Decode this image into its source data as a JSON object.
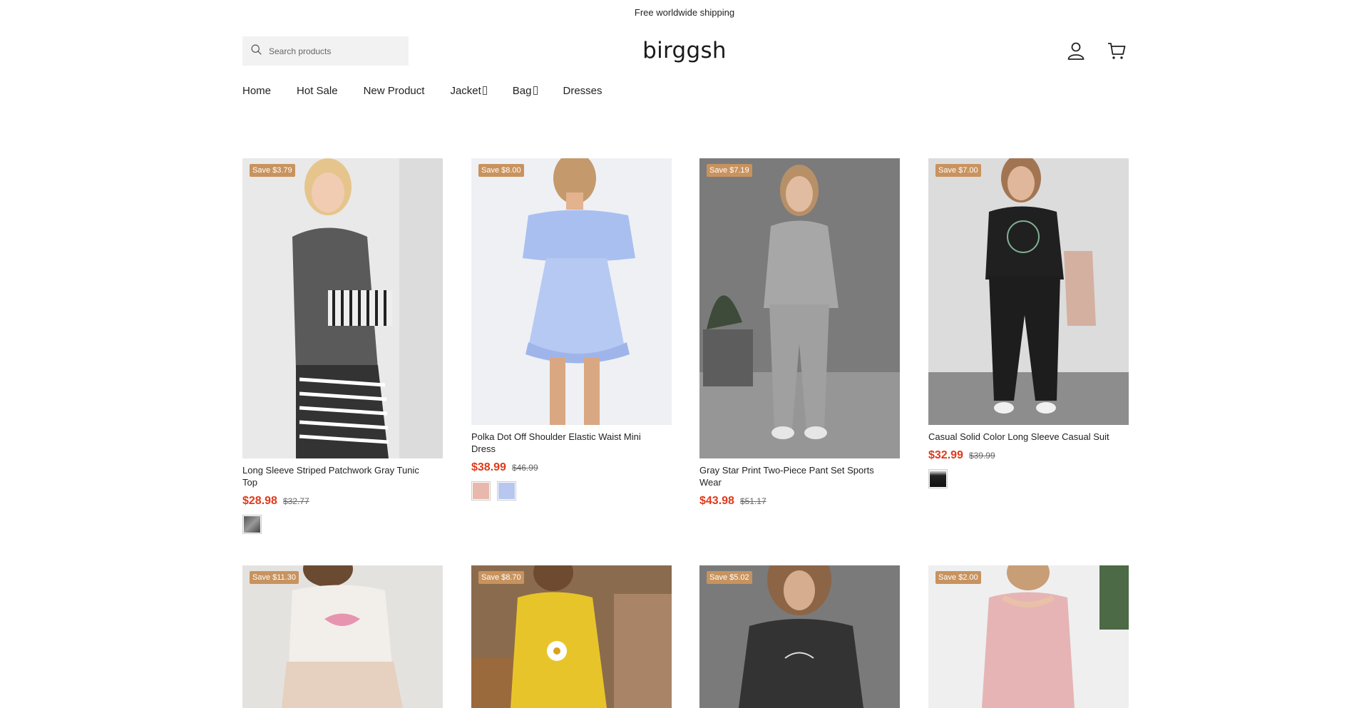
{
  "announcement": "Free worldwide shipping",
  "header": {
    "logo": "birggsh",
    "search_placeholder": "Search products"
  },
  "nav": [
    {
      "label": "Home"
    },
    {
      "label": "Hot Sale"
    },
    {
      "label": "New Product"
    },
    {
      "label": "Jacket"
    },
    {
      "label": "Bag"
    },
    {
      "label": "Dresses"
    }
  ],
  "products": [
    {
      "badge": "Save $3.79",
      "title": "Long Sleeve Striped Patchwork Gray Tunic Top",
      "price": "$28.98",
      "compare": "$32.77"
    },
    {
      "badge": "Save $8.00",
      "title": "Polka Dot Off Shoulder Elastic Waist Mini Dress",
      "price": "$38.99",
      "compare": "$46.99"
    },
    {
      "badge": "Save $7.19",
      "title": "Gray Star Print Two-Piece Pant Set Sports Wear",
      "price": "$43.98",
      "compare": "$51.17"
    },
    {
      "badge": "Save $7.00",
      "title": "Casual Solid Color Long Sleeve Casual Suit",
      "price": "$32.99",
      "compare": "$39.99"
    },
    {
      "badge": "Save $11.30"
    },
    {
      "badge": "Save $8.70"
    },
    {
      "badge": "Save $5.02"
    },
    {
      "badge": "Save $2.00"
    }
  ],
  "colors": {
    "badge": "#c8935e",
    "price": "#e0391a",
    "search_bg": "#f2f2f2"
  },
  "icons": [
    "search-icon",
    "user-icon",
    "cart-icon"
  ]
}
